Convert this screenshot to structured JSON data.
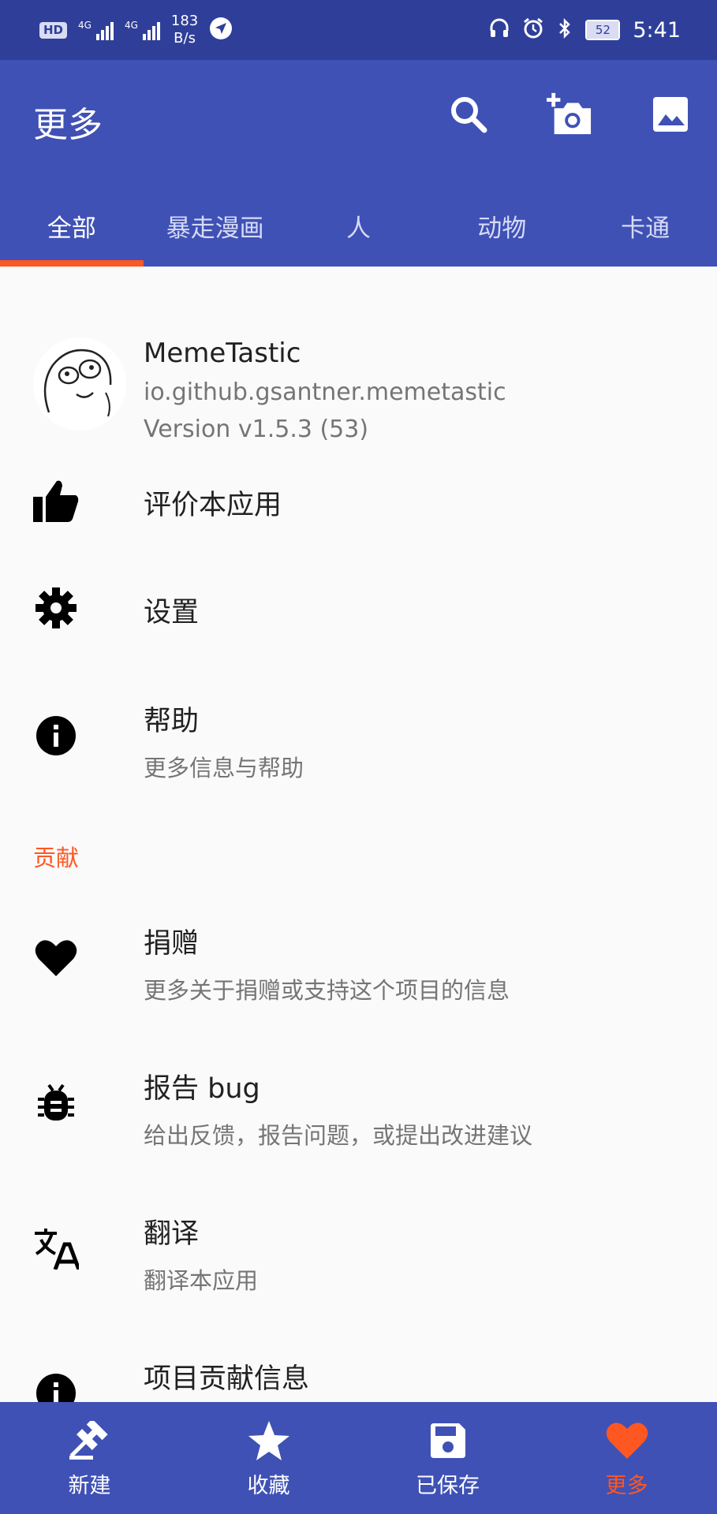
{
  "status_bar": {
    "hd": "HD",
    "net1": "4G",
    "net2": "4G",
    "speed_value": "183",
    "speed_unit": "B/s",
    "battery": "52",
    "time": "5:41"
  },
  "app_bar": {
    "title": "更多"
  },
  "tabs": [
    {
      "label": "全部"
    },
    {
      "label": "暴走漫画"
    },
    {
      "label": "人"
    },
    {
      "label": "动物"
    },
    {
      "label": "卡通"
    }
  ],
  "app_info": {
    "name": "MemeTastic",
    "package": "io.github.gsantner.memetastic",
    "version": "Version v1.5.3 (53)"
  },
  "items": [
    {
      "title": "评价本应用",
      "subtitle": ""
    },
    {
      "title": "设置",
      "subtitle": ""
    },
    {
      "title": "帮助",
      "subtitle": "更多信息与帮助"
    },
    {
      "title": "捐赠",
      "subtitle": "更多关于捐赠或支持这个项目的信息"
    },
    {
      "title": "报告 bug",
      "subtitle": "给出反馈，报告问题，或提出改进建议"
    },
    {
      "title": "翻译",
      "subtitle": "翻译本应用"
    },
    {
      "title": "项目贡献信息",
      "subtitle": ""
    }
  ],
  "section": {
    "contribute": "贡献"
  },
  "bottom_nav": [
    {
      "label": "新建"
    },
    {
      "label": "收藏"
    },
    {
      "label": "已保存"
    },
    {
      "label": "更多"
    }
  ],
  "colors": {
    "primary": "#3f51b5",
    "status_bar": "#2f3f99",
    "accent": "#ff5722"
  }
}
